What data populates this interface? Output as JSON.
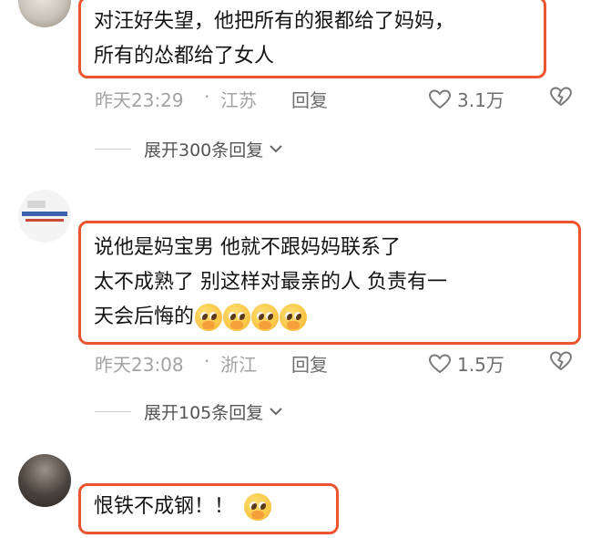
{
  "comments": [
    {
      "lines": [
        "对汪好失望，他把所有的狠都给了妈妈，",
        "所有的怂都给了女人"
      ],
      "time": "昨天23:29",
      "separator": "·",
      "location": "江苏",
      "reply_label": "回复",
      "likes": "3.1万",
      "expand_label": "展开300条回复",
      "avatar_colors": [
        "#d8d4cc",
        "#9c948a"
      ]
    },
    {
      "lines": [
        "说他是妈宝男   他就不跟妈妈联系了",
        "太不成熟了   别这样对最亲的人   负责有一",
        "天会后悔的"
      ],
      "emoji_count": 4,
      "time": "昨天23:08",
      "separator": "·",
      "location": "浙江",
      "reply_label": "回复",
      "likes": "1.5万",
      "expand_label": "展开105条回复",
      "avatar_colors": [
        "#f2f2f2",
        "#2f5aa8"
      ]
    },
    {
      "lines": [
        "恨铁不成钢！！"
      ],
      "emoji_count": 1,
      "avatar_colors": [
        "#3a3531",
        "#8a8178"
      ]
    }
  ],
  "colors": {
    "highlight_border": "#ec5530",
    "meta_text": "#a3a3a3",
    "icon": "#7a7a7a"
  },
  "icons": {
    "like": "heart-outline-icon",
    "dislike": "broken-heart-icon",
    "expand": "chevron-down-icon"
  }
}
